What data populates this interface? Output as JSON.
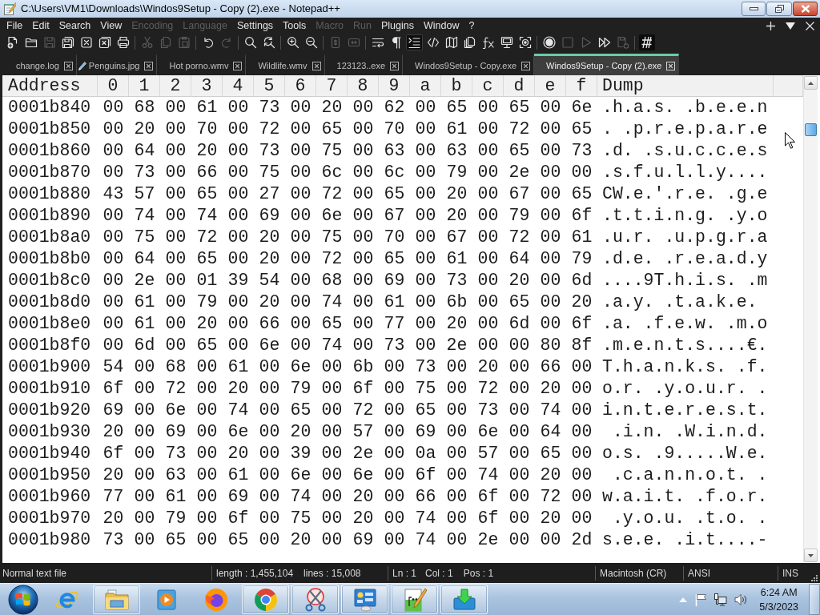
{
  "window": {
    "title": "C:\\Users\\VM1\\Downloads\\Windos9Setup - Copy (2).exe - Notepad++"
  },
  "menu": [
    {
      "label": "File",
      "disabled": false
    },
    {
      "label": "Edit",
      "disabled": false
    },
    {
      "label": "Search",
      "disabled": false
    },
    {
      "label": "View",
      "disabled": false
    },
    {
      "label": "Encoding",
      "disabled": true
    },
    {
      "label": "Language",
      "disabled": true
    },
    {
      "label": "Settings",
      "disabled": false
    },
    {
      "label": "Tools",
      "disabled": false
    },
    {
      "label": "Macro",
      "disabled": true
    },
    {
      "label": "Run",
      "disabled": true
    },
    {
      "label": "Plugins",
      "disabled": false
    },
    {
      "label": "Window",
      "disabled": false
    },
    {
      "label": "?",
      "disabled": false
    }
  ],
  "toolbar": [
    {
      "buttons": [
        {
          "disabled": false,
          "checked": false
        },
        {
          "disabled": false,
          "checked": false
        },
        {
          "disabled": true,
          "checked": false
        },
        {
          "disabled": false,
          "checked": false
        },
        {
          "disabled": false,
          "checked": false
        },
        {
          "disabled": false,
          "checked": false
        },
        {
          "disabled": false,
          "checked": false
        }
      ]
    },
    {
      "buttons": [
        {
          "disabled": true,
          "checked": false
        },
        {
          "disabled": true,
          "checked": false
        },
        {
          "disabled": true,
          "checked": false
        }
      ]
    },
    {
      "buttons": [
        {
          "disabled": false,
          "checked": false
        },
        {
          "disabled": true,
          "checked": false
        }
      ]
    },
    {
      "buttons": [
        {
          "disabled": false,
          "checked": false
        },
        {
          "disabled": false,
          "checked": false
        }
      ]
    },
    {
      "buttons": [
        {
          "disabled": false,
          "checked": false
        },
        {
          "disabled": false,
          "checked": false
        }
      ]
    },
    {
      "buttons": [
        {
          "disabled": true,
          "checked": false
        },
        {
          "disabled": true,
          "checked": false
        }
      ]
    },
    {
      "buttons": [
        {
          "disabled": false,
          "checked": false
        },
        {
          "disabled": false,
          "checked": false
        },
        {
          "disabled": false,
          "checked": true
        },
        {
          "disabled": false,
          "checked": false
        },
        {
          "disabled": false,
          "checked": false
        },
        {
          "disabled": false,
          "checked": false
        },
        {
          "disabled": false,
          "checked": false
        },
        {
          "disabled": false,
          "checked": false
        },
        {
          "disabled": false,
          "checked": false
        }
      ]
    },
    {
      "buttons": [
        {
          "disabled": false,
          "checked": false
        },
        {
          "disabled": true,
          "checked": false
        },
        {
          "disabled": true,
          "checked": false
        },
        {
          "disabled": false,
          "checked": false
        },
        {
          "disabled": true,
          "checked": false
        }
      ]
    },
    {
      "buttons": [
        {
          "disabled": false,
          "checked": false
        }
      ]
    }
  ],
  "tabs": [
    {
      "label": "change.log",
      "selected": false,
      "modified": false
    },
    {
      "label": "Penguins.jpg",
      "selected": false,
      "modified": true
    },
    {
      "label": "Hot porno.wmv",
      "selected": false,
      "modified": false
    },
    {
      "label": "Wildlife.wmv",
      "selected": false,
      "modified": false
    },
    {
      "label": "123123..exe",
      "selected": false,
      "modified": false
    },
    {
      "label": "Windos9Setup - Copy.exe",
      "selected": false,
      "modified": false
    },
    {
      "label": "Windos9Setup - Copy (2).exe",
      "selected": true,
      "modified": false
    }
  ],
  "hex_view": {
    "columns": [
      "Address",
      "0",
      "1",
      "2",
      "3",
      "4",
      "5",
      "6",
      "7",
      "8",
      "9",
      "a",
      "b",
      "c",
      "d",
      "e",
      "f",
      "Dump"
    ],
    "rows": [
      {
        "address": "0001b840",
        "bytes": [
          "00",
          "68",
          "00",
          "61",
          "00",
          "73",
          "00",
          "20",
          "00",
          "62",
          "00",
          "65",
          "00",
          "65",
          "00",
          "6e"
        ],
        "dump": ".h.a.s. .b.e.e.n"
      },
      {
        "address": "0001b850",
        "bytes": [
          "00",
          "20",
          "00",
          "70",
          "00",
          "72",
          "00",
          "65",
          "00",
          "70",
          "00",
          "61",
          "00",
          "72",
          "00",
          "65"
        ],
        "dump": ". .p.r.e.p.a.r.e"
      },
      {
        "address": "0001b860",
        "bytes": [
          "00",
          "64",
          "00",
          "20",
          "00",
          "73",
          "00",
          "75",
          "00",
          "63",
          "00",
          "63",
          "00",
          "65",
          "00",
          "73"
        ],
        "dump": ".d. .s.u.c.c.e.s"
      },
      {
        "address": "0001b870",
        "bytes": [
          "00",
          "73",
          "00",
          "66",
          "00",
          "75",
          "00",
          "6c",
          "00",
          "6c",
          "00",
          "79",
          "00",
          "2e",
          "00",
          "00"
        ],
        "dump": ".s.f.u.l.l.y...."
      },
      {
        "address": "0001b880",
        "bytes": [
          "43",
          "57",
          "00",
          "65",
          "00",
          "27",
          "00",
          "72",
          "00",
          "65",
          "00",
          "20",
          "00",
          "67",
          "00",
          "65"
        ],
        "dump": "CW.e.'.r.e. .g.e"
      },
      {
        "address": "0001b890",
        "bytes": [
          "00",
          "74",
          "00",
          "74",
          "00",
          "69",
          "00",
          "6e",
          "00",
          "67",
          "00",
          "20",
          "00",
          "79",
          "00",
          "6f"
        ],
        "dump": ".t.t.i.n.g. .y.o"
      },
      {
        "address": "0001b8a0",
        "bytes": [
          "00",
          "75",
          "00",
          "72",
          "00",
          "20",
          "00",
          "75",
          "00",
          "70",
          "00",
          "67",
          "00",
          "72",
          "00",
          "61"
        ],
        "dump": ".u.r. .u.p.g.r.a"
      },
      {
        "address": "0001b8b0",
        "bytes": [
          "00",
          "64",
          "00",
          "65",
          "00",
          "20",
          "00",
          "72",
          "00",
          "65",
          "00",
          "61",
          "00",
          "64",
          "00",
          "79"
        ],
        "dump": ".d.e. .r.e.a.d.y"
      },
      {
        "address": "0001b8c0",
        "bytes": [
          "00",
          "2e",
          "00",
          "01",
          "39",
          "54",
          "00",
          "68",
          "00",
          "69",
          "00",
          "73",
          "00",
          "20",
          "00",
          "6d"
        ],
        "dump": "....9T.h.i.s. .m"
      },
      {
        "address": "0001b8d0",
        "bytes": [
          "00",
          "61",
          "00",
          "79",
          "00",
          "20",
          "00",
          "74",
          "00",
          "61",
          "00",
          "6b",
          "00",
          "65",
          "00",
          "20"
        ],
        "dump": ".a.y. .t.a.k.e."
      },
      {
        "address": "0001b8e0",
        "bytes": [
          "00",
          "61",
          "00",
          "20",
          "00",
          "66",
          "00",
          "65",
          "00",
          "77",
          "00",
          "20",
          "00",
          "6d",
          "00",
          "6f"
        ],
        "dump": ".a. .f.e.w. .m.o"
      },
      {
        "address": "0001b8f0",
        "bytes": [
          "00",
          "6d",
          "00",
          "65",
          "00",
          "6e",
          "00",
          "74",
          "00",
          "73",
          "00",
          "2e",
          "00",
          "00",
          "80",
          "8f"
        ],
        "dump": ".m.e.n.t.s....€."
      },
      {
        "address": "0001b900",
        "bytes": [
          "54",
          "00",
          "68",
          "00",
          "61",
          "00",
          "6e",
          "00",
          "6b",
          "00",
          "73",
          "00",
          "20",
          "00",
          "66",
          "00"
        ],
        "dump": "T.h.a.n.k.s. .f."
      },
      {
        "address": "0001b910",
        "bytes": [
          "6f",
          "00",
          "72",
          "00",
          "20",
          "00",
          "79",
          "00",
          "6f",
          "00",
          "75",
          "00",
          "72",
          "00",
          "20",
          "00"
        ],
        "dump": "o.r. .y.o.u.r. ."
      },
      {
        "address": "0001b920",
        "bytes": [
          "69",
          "00",
          "6e",
          "00",
          "74",
          "00",
          "65",
          "00",
          "72",
          "00",
          "65",
          "00",
          "73",
          "00",
          "74",
          "00"
        ],
        "dump": "i.n.t.e.r.e.s.t."
      },
      {
        "address": "0001b930",
        "bytes": [
          "20",
          "00",
          "69",
          "00",
          "6e",
          "00",
          "20",
          "00",
          "57",
          "00",
          "69",
          "00",
          "6e",
          "00",
          "64",
          "00"
        ],
        "dump": " .i.n. .W.i.n.d."
      },
      {
        "address": "0001b940",
        "bytes": [
          "6f",
          "00",
          "73",
          "00",
          "20",
          "00",
          "39",
          "00",
          "2e",
          "00",
          "0a",
          "00",
          "57",
          "00",
          "65",
          "00"
        ],
        "dump": "o.s. .9.....W.e."
      },
      {
        "address": "0001b950",
        "bytes": [
          "20",
          "00",
          "63",
          "00",
          "61",
          "00",
          "6e",
          "00",
          "6e",
          "00",
          "6f",
          "00",
          "74",
          "00",
          "20",
          "00"
        ],
        "dump": " .c.a.n.n.o.t. ."
      },
      {
        "address": "0001b960",
        "bytes": [
          "77",
          "00",
          "61",
          "00",
          "69",
          "00",
          "74",
          "00",
          "20",
          "00",
          "66",
          "00",
          "6f",
          "00",
          "72",
          "00"
        ],
        "dump": "w.a.i.t. .f.o.r."
      },
      {
        "address": "0001b970",
        "bytes": [
          "20",
          "00",
          "79",
          "00",
          "6f",
          "00",
          "75",
          "00",
          "20",
          "00",
          "74",
          "00",
          "6f",
          "00",
          "20",
          "00"
        ],
        "dump": " .y.o.u. .t.o. ."
      },
      {
        "address": "0001b980",
        "bytes": [
          "73",
          "00",
          "65",
          "00",
          "65",
          "00",
          "20",
          "00",
          "69",
          "00",
          "74",
          "00",
          "2e",
          "00",
          "00",
          "2d"
        ],
        "dump": "s.e.e. .i.t....-"
      }
    ]
  },
  "status_bar": {
    "file_type": "Normal text file",
    "length": "length : 1,455,104",
    "lines": "lines : 15,008",
    "line": "Ln : 1",
    "column": "Col : 1",
    "position": "Pos : 1",
    "eol": "Macintosh (CR)",
    "encoding": "ANSI",
    "mode": "INS"
  },
  "taskbar": {
    "buttons": [
      {
        "running": false
      },
      {
        "running": true
      },
      {
        "running": false
      },
      {
        "running": false
      },
      {
        "running": true
      },
      {
        "running": true
      },
      {
        "running": true
      },
      {
        "running": true
      },
      {
        "running": true
      }
    ],
    "clock": {
      "time": "6:24 AM",
      "date": "5/3/2023"
    }
  }
}
